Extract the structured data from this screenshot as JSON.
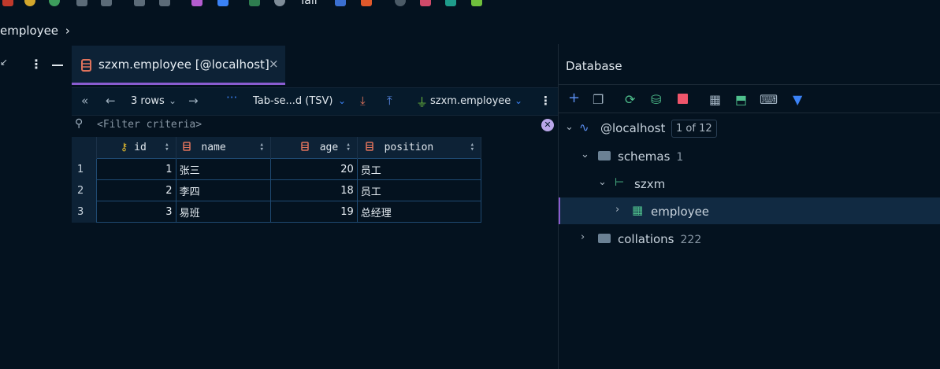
{
  "topbar": {
    "tail_label": "Tail"
  },
  "breadcrumb": {
    "label": "employee"
  },
  "tab": {
    "label": "szxm.employee [@localhost]",
    "close": "×"
  },
  "toolbar": {
    "rows": "3 rows",
    "format": "Tab-se...d (TSV)",
    "datasource": "szxm.employee"
  },
  "filter": {
    "placeholder": "<Filter criteria>"
  },
  "grid": {
    "columns": [
      "id",
      "name",
      "age",
      "position"
    ],
    "rows": [
      {
        "rn": "1",
        "id": "1",
        "name": "张三",
        "age": "20",
        "position": "员工"
      },
      {
        "rn": "2",
        "id": "2",
        "name": "李四",
        "age": "18",
        "position": "员工"
      },
      {
        "rn": "3",
        "id": "3",
        "name": "易班",
        "age": "19",
        "position": "总经理"
      }
    ]
  },
  "database": {
    "title": "Database",
    "host": "@localhost",
    "host_badge": "1 of 12",
    "schemas_label": "schemas",
    "schemas_count": "1",
    "schema_name": "szxm",
    "table_name": "employee",
    "collations_label": "collations",
    "collations_count": "222"
  },
  "colors": {
    "accent": "#8a5cd0",
    "background": "#04121f",
    "selection": "#112a42"
  }
}
